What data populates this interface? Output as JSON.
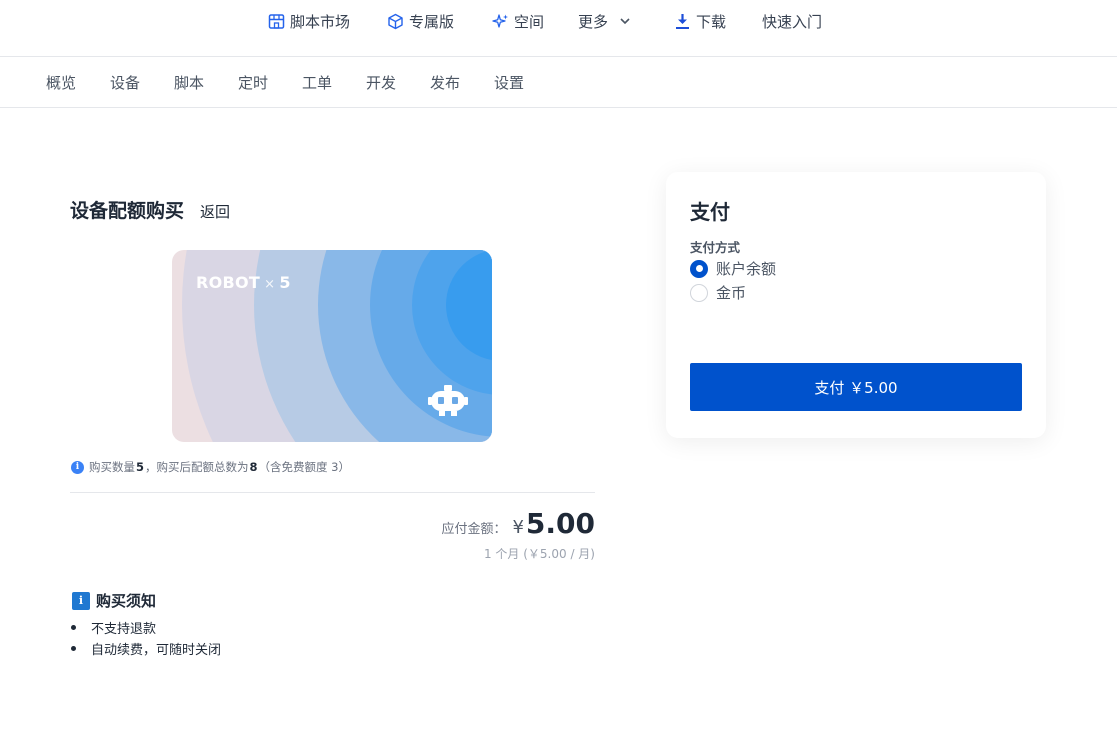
{
  "topnav": {
    "items": [
      {
        "label": "脚本市场",
        "icon": "store-icon"
      },
      {
        "label": "专属版",
        "icon": "box-icon"
      },
      {
        "label": "空间",
        "icon": "sparkle-icon"
      },
      {
        "label": "更多",
        "icon": "chevron-down-icon"
      },
      {
        "label": "下载",
        "icon": "download-icon"
      },
      {
        "label": "快速入门"
      }
    ]
  },
  "subnav": {
    "tabs": [
      "概览",
      "设备",
      "脚本",
      "定时",
      "工单",
      "开发",
      "发布",
      "设置"
    ]
  },
  "page": {
    "title": "设备配额购买",
    "back_label": "返回"
  },
  "card": {
    "brand": "ROBOT",
    "times": "×",
    "quantity": "5",
    "icon": "robot-icon"
  },
  "info": {
    "prefix": "购买数量",
    "quantity": "5",
    "middle": "，购买后配额总数为",
    "total": "8",
    "suffix": "（含免费额度 3）"
  },
  "amount": {
    "label": "应付金额：",
    "currency": "¥",
    "value": "5.00",
    "period_note": "1 个月 (￥5.00 / 月)"
  },
  "notice": {
    "icon_text": "i",
    "title": "购买须知",
    "items": [
      "不支持退款",
      "自动续费，可随时关闭"
    ]
  },
  "payment": {
    "title": "支付",
    "method_label": "支付方式",
    "options": [
      {
        "label": "账户余额",
        "selected": true
      },
      {
        "label": "金币",
        "selected": false
      }
    ],
    "button_label": "支付 ￥5.00"
  },
  "colors": {
    "primary": "#0052cc",
    "card_bg": "#ecdfe2",
    "card_blue": "#3b9ded"
  }
}
